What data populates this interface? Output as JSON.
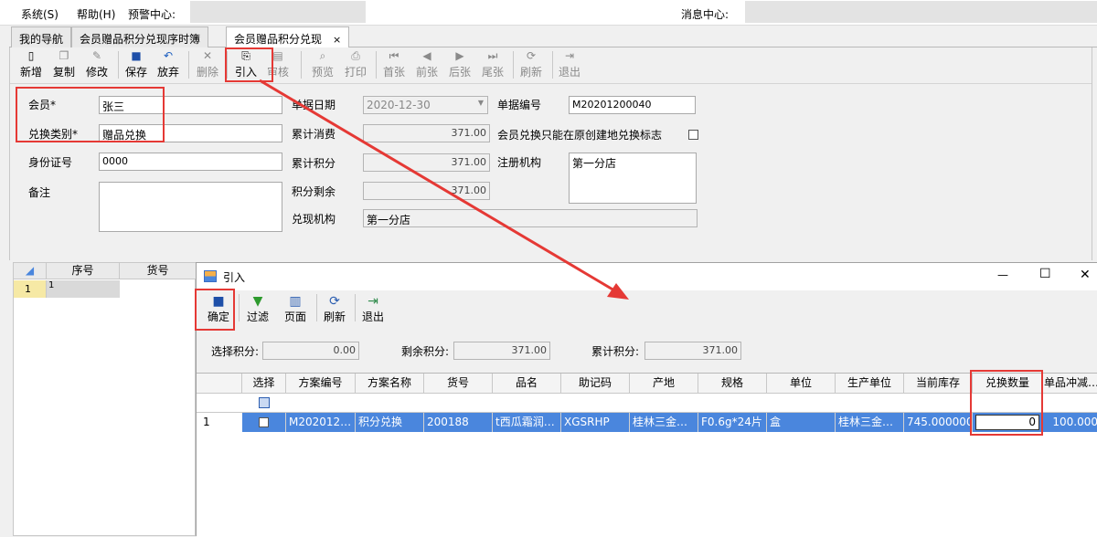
{
  "menu": {
    "system": "系统(S)",
    "help": "帮助(H)",
    "alert": "预警中心:",
    "message": "消息中心:"
  },
  "tabs": [
    {
      "label": "我的导航"
    },
    {
      "label": "会员赠品积分兑现序时簿"
    },
    {
      "label": "会员赠品积分兑现",
      "close": "×"
    }
  ],
  "toolbar": [
    {
      "label": "新增",
      "icon": "new-icon"
    },
    {
      "label": "复制",
      "icon": "copy-icon"
    },
    {
      "label": "修改",
      "icon": "edit-icon"
    },
    {
      "label": "保存",
      "icon": "save-icon"
    },
    {
      "label": "放弃",
      "icon": "undo-icon"
    },
    {
      "label": "删除",
      "icon": "delete-icon"
    },
    {
      "label": "引入",
      "icon": "import-icon"
    },
    {
      "label": "审核",
      "icon": "audit-icon"
    },
    {
      "label": "预览",
      "icon": "preview-icon"
    },
    {
      "label": "打印",
      "icon": "print-icon"
    },
    {
      "label": "首张",
      "icon": "first-icon"
    },
    {
      "label": "前张",
      "icon": "prev-icon"
    },
    {
      "label": "后张",
      "icon": "next-icon"
    },
    {
      "label": "尾张",
      "icon": "last-icon"
    },
    {
      "label": "刷新",
      "icon": "refresh-icon"
    },
    {
      "label": "退出",
      "icon": "exit-icon"
    }
  ],
  "form": {
    "member_label": "会员*",
    "member_value": "张三",
    "type_label": "兑换类别*",
    "type_value": "赠品兑换",
    "id_label": "身份证号",
    "id_value": "0000",
    "note_label": "备注",
    "note_value": "",
    "date_label": "单据日期",
    "date_value": "2020-12-30",
    "total_spend_label": "累计消费",
    "total_spend_value": "371.00",
    "total_points_label": "累计积分",
    "total_points_value": "371.00",
    "remaining_label": "积分剩余",
    "remaining_value": "371.00",
    "redeem_org_label": "兑现机构",
    "redeem_org_value": "第一分店",
    "doc_no_label": "单据编号",
    "doc_no_value": "M20201200040",
    "only_origin_label": "会员兑换只能在原创建地兑换标志",
    "reg_org_label": "注册机构",
    "reg_org_value": "第一分店"
  },
  "left_grid": {
    "headers": [
      "序号",
      "货号"
    ],
    "row_no": "1",
    "row_val": "1"
  },
  "dialog": {
    "title": "引入",
    "win_min": "—",
    "win_max": "☐",
    "win_close": "✕",
    "toolbar": [
      {
        "label": "确定",
        "icon": "save-icon"
      },
      {
        "label": "过滤",
        "icon": "filter-icon"
      },
      {
        "label": "页面",
        "icon": "page-icon"
      },
      {
        "label": "刷新",
        "icon": "refresh-icon"
      },
      {
        "label": "退出",
        "icon": "exit-icon"
      }
    ],
    "sel_points_label": "选择积分:",
    "sel_points_value": "0.00",
    "remain_points_label": "剩余积分:",
    "remain_points_value": "371.00",
    "total_points_label": "累计积分:",
    "total_points_value": "371.00",
    "columns": [
      "选择",
      "方案编号",
      "方案名称",
      "货号",
      "品名",
      "助记码",
      "产地",
      "规格",
      "单位",
      "生产单位",
      "当前库存",
      "兑换数量",
      "单品冲减…"
    ],
    "row": {
      "no": "1",
      "plan_no": "M202012…",
      "plan_name": "积分兑换",
      "item_no": "200188",
      "name": "t西瓜霜润…",
      "code": "XGSRHP",
      "origin": "桂林三金…",
      "spec": "F0.6g*24片",
      "unit": "盒",
      "maker": "桂林三金…",
      "stock": "745.000000",
      "qty": "0",
      "deduct": "100.000"
    }
  },
  "colors": {
    "accent_red": "#e53935",
    "row_highlight": "#4a86dd"
  }
}
